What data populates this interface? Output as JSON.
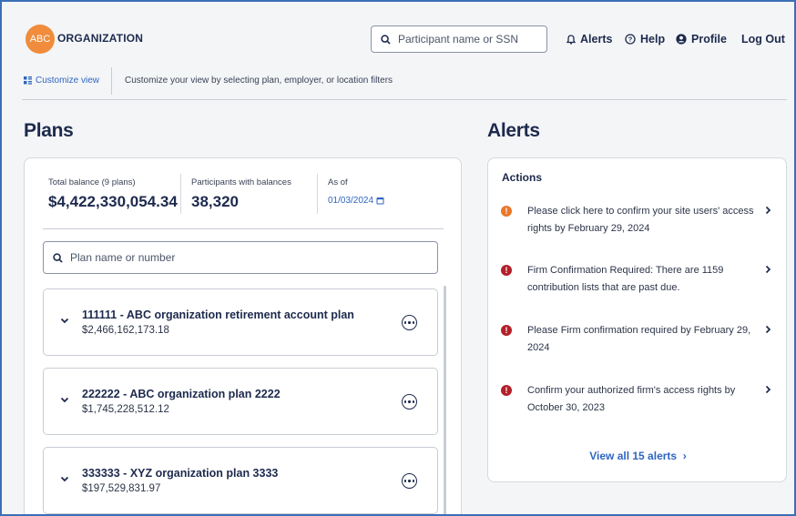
{
  "header": {
    "logo_mark": "ABC",
    "org_name": "ORGANIZATION",
    "search_placeholder": "Participant name or SSN",
    "nav": {
      "alerts": "Alerts",
      "help": "Help",
      "profile": "Profile",
      "logout": "Log Out"
    }
  },
  "subbar": {
    "customize_label": "Customize view",
    "description": "Customize your view by selecting plan, employer, or location filters"
  },
  "plans": {
    "title": "Plans",
    "summary": {
      "total_label": "Total balance (9 plans)",
      "total_value": "$4,422,330,054.34",
      "participants_label": "Participants with balances",
      "participants_value": "38,320",
      "asof_label": "As of",
      "asof_date": "01/03/2024"
    },
    "search_placeholder": "Plan name or number",
    "items": [
      {
        "name": "111111 - ABC organization retirement account plan",
        "amount": "$2,466,162,173.18"
      },
      {
        "name": "222222 - ABC organization plan 2222",
        "amount": "$1,745,228,512.12"
      },
      {
        "name": "333333 - XYZ organization plan 3333",
        "amount": "$197,529,831.97"
      }
    ]
  },
  "alerts": {
    "title": "Alerts",
    "actions_label": "Actions",
    "items": [
      {
        "text": "Please click here to confirm your site users' access rights by February 29, 2024",
        "severity": "warning",
        "color": "#e8782a"
      },
      {
        "text": "Firm Confirmation Required: There are 1159 contribution lists that are past due.",
        "severity": "error",
        "color": "#b3202a"
      },
      {
        "text": "Please Firm confirmation required by February 29, 2024",
        "severity": "error",
        "color": "#b3202a"
      },
      {
        "text": "Confirm your authorized firm's access rights by October 30, 2023",
        "severity": "error",
        "color": "#b3202a"
      }
    ],
    "view_all": "View all 15 alerts"
  },
  "colors": {
    "brand_orange": "#f08c3b",
    "navy": "#1d2a4d",
    "link_blue": "#2f66c0"
  }
}
